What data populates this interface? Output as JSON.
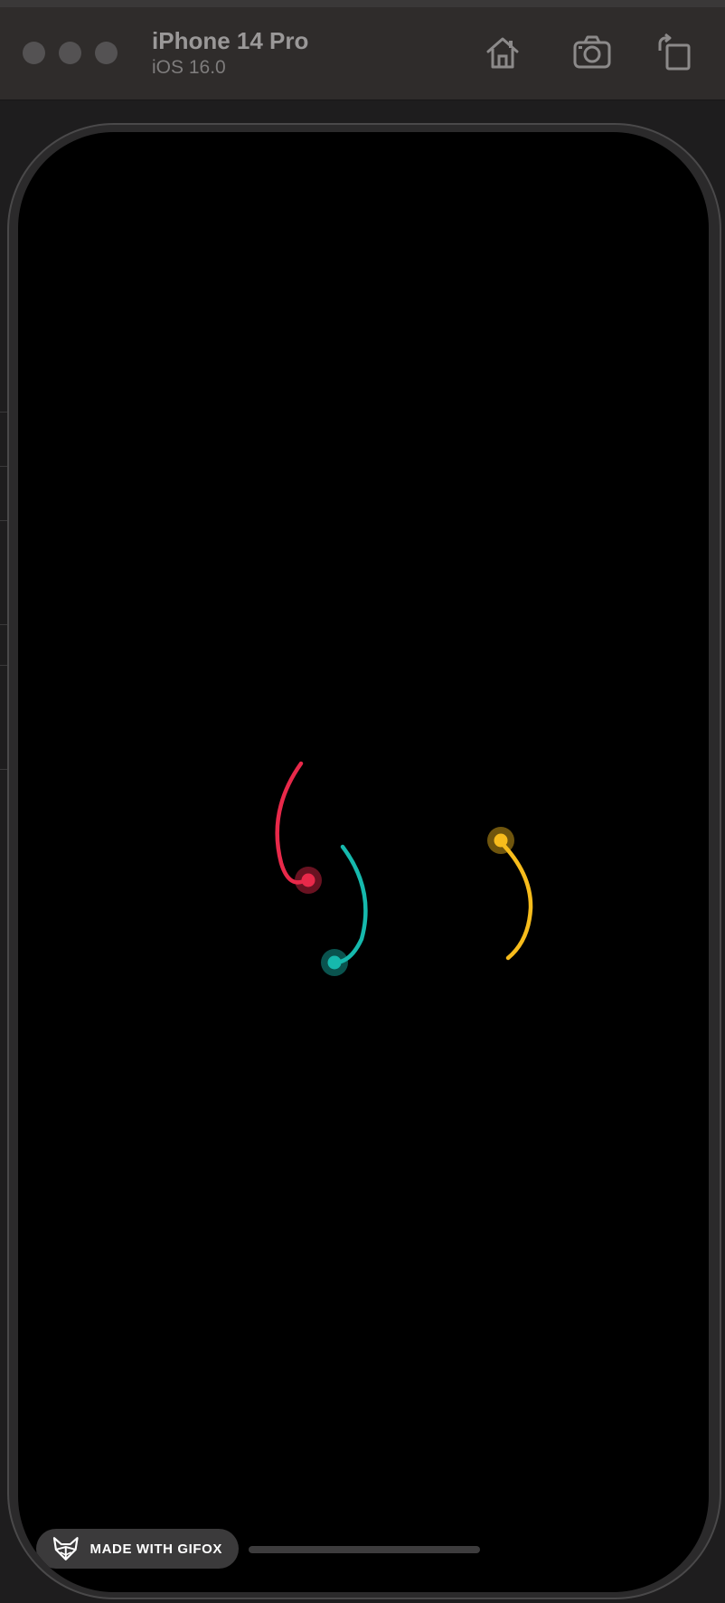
{
  "window": {
    "device_name": "iPhone 14 Pro",
    "os_version": "iOS 16.0",
    "toolbar_icons": [
      "home-icon",
      "screenshot-icon",
      "rotate-icon"
    ],
    "traffic_lights": [
      "close",
      "minimize",
      "zoom"
    ]
  },
  "screen": {
    "background": "#000000",
    "loader_colors": {
      "red": "#e8294a",
      "teal": "#16b9ad",
      "yellow": "#f7bc1c"
    }
  },
  "watermark": {
    "text": "MADE WITH GIFOX",
    "icon": "fox-icon"
  }
}
